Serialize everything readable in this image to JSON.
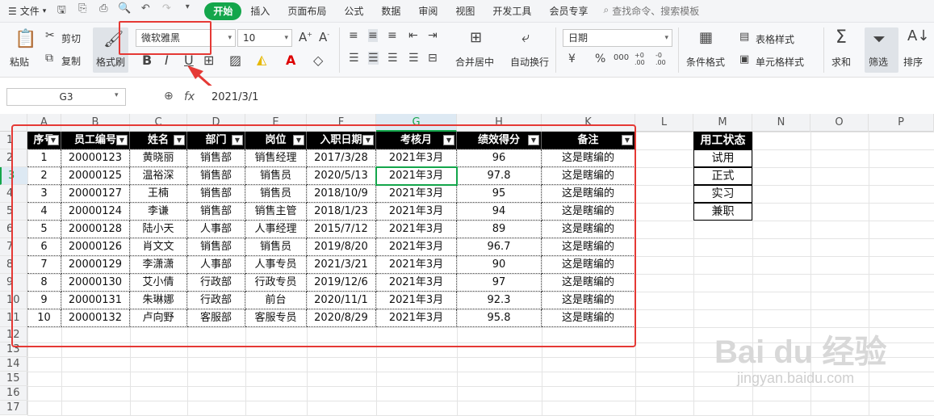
{
  "menubar": {
    "file_label": "文件",
    "tabs": [
      "开始",
      "插入",
      "页面布局",
      "公式",
      "数据",
      "审阅",
      "视图",
      "开发工具",
      "会员专享"
    ],
    "active_tab": "开始",
    "search_placeholder": "查找命令、搜索模板"
  },
  "ribbon": {
    "paste": "粘贴",
    "cut": "剪切",
    "copy": "复制",
    "format_painter": "格式刷",
    "font_name": "微软雅黑",
    "font_size": "10",
    "bold": "B",
    "italic": "I",
    "underline": "U",
    "merge_center": "合并居中",
    "wrap_text": "自动换行",
    "number_format": "日期",
    "currency": "¥",
    "percent": "%",
    "thousands": "000",
    "dec_inc": "+0 .00",
    "dec_dec": "-0 .00",
    "conditional_format": "条件格式",
    "table_style": "表格样式",
    "cell_style": "单元格样式",
    "sum": "求和",
    "filter": "筛选",
    "sort": "排序"
  },
  "formula_bar": {
    "name_box": "G3",
    "fx": "fx",
    "value": "2021/3/1"
  },
  "columns": [
    "A",
    "B",
    "C",
    "D",
    "E",
    "F",
    "G",
    "H",
    "K",
    "L",
    "M",
    "N",
    "O",
    "P"
  ],
  "selected_column": "G",
  "rows": [
    "1",
    "2",
    "3",
    "4",
    "5",
    "6",
    "7",
    "8",
    "9",
    "10",
    "11",
    "12",
    "13",
    "14",
    "15",
    "16",
    "17"
  ],
  "selected_row": "3",
  "table": {
    "headers": [
      "序号",
      "员工编号",
      "姓名",
      "部门",
      "岗位",
      "入职日期",
      "考核月",
      "绩效得分",
      "备注"
    ],
    "rows": [
      [
        "1",
        "20000123",
        "黄晓丽",
        "销售部",
        "销售经理",
        "2017/3/28",
        "2021年3月",
        "96",
        "这是瞎编的"
      ],
      [
        "2",
        "20000125",
        "温裕深",
        "销售部",
        "销售员",
        "2020/5/13",
        "2021年3月",
        "97.8",
        "这是瞎编的"
      ],
      [
        "3",
        "20000127",
        "王楠",
        "销售部",
        "销售员",
        "2018/10/9",
        "2021年3月",
        "95",
        "这是瞎编的"
      ],
      [
        "4",
        "20000124",
        "李谦",
        "销售部",
        "销售主管",
        "2018/1/23",
        "2021年3月",
        "94",
        "这是瞎编的"
      ],
      [
        "5",
        "20000128",
        "陆小天",
        "人事部",
        "人事经理",
        "2015/7/12",
        "2021年3月",
        "89",
        "这是瞎编的"
      ],
      [
        "6",
        "20000126",
        "肖文文",
        "销售部",
        "销售员",
        "2019/8/20",
        "2021年3月",
        "96.7",
        "这是瞎编的"
      ],
      [
        "7",
        "20000129",
        "李潇潇",
        "人事部",
        "人事专员",
        "2021/3/21",
        "2021年3月",
        "90",
        "这是瞎编的"
      ],
      [
        "8",
        "20000130",
        "艾小倩",
        "行政部",
        "行政专员",
        "2019/12/6",
        "2021年3月",
        "97",
        "这是瞎编的"
      ],
      [
        "9",
        "20000131",
        "朱琳娜",
        "行政部",
        "前台",
        "2020/11/1",
        "2021年3月",
        "92.3",
        "这是瞎编的"
      ],
      [
        "10",
        "20000132",
        "卢向野",
        "客服部",
        "客服专员",
        "2020/8/29",
        "2021年3月",
        "95.8",
        "这是瞎编的"
      ]
    ]
  },
  "status_list": {
    "header": "用工状态",
    "items": [
      "试用",
      "正式",
      "实习",
      "兼职"
    ]
  },
  "watermark": {
    "main": "Bai du 经验",
    "sub": "jingyan.baidu.com"
  }
}
